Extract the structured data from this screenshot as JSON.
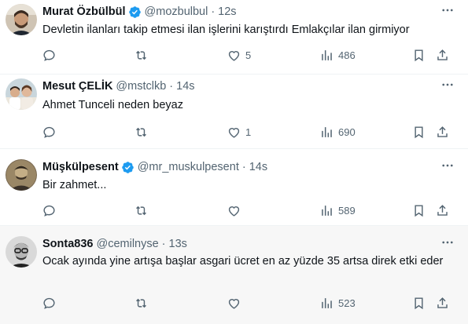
{
  "tweets": [
    {
      "name": "Murat Özbülbül",
      "handle": "@mozbulbul",
      "separator": "·",
      "time": "12s",
      "verified": true,
      "text": "Devletin ilanları takip etmesi ilan işlerini karıştırdı Emlakçılar ilan girmiyor",
      "likes": "5",
      "views": "486",
      "avatar": "avatar-man-beard"
    },
    {
      "name": "Mesut ÇELİK",
      "handle": "@mstclkb",
      "separator": "·",
      "time": "14s",
      "verified": false,
      "text": "Ahmet Tunceli neden beyaz",
      "likes": "1",
      "views": "690",
      "avatar": "avatar-group-photo"
    },
    {
      "name": "Müşkülpesent",
      "handle": "@mr_muskulpesent",
      "separator": "·",
      "time": "14s",
      "verified": true,
      "text": "Bir zahmet...",
      "likes": "",
      "views": "589",
      "avatar": "avatar-sepia-portrait"
    },
    {
      "name": "Sonta836",
      "handle": "@cemilnyse",
      "separator": "·",
      "time": "13s",
      "verified": false,
      "text": "Ocak ayında yine artışa başlar asgari ücret en az yüzde 35 artsa direk etki eder",
      "likes": "",
      "views": "523",
      "avatar": "avatar-bw-glasses"
    }
  ],
  "colors": {
    "verified": "#1d9bf0",
    "muted": "#536471",
    "text": "#0f1419",
    "divider": "#eff3f4",
    "highlight_bg": "#f7f7f7"
  },
  "icons": [
    "reply-icon",
    "retweet-icon",
    "like-icon",
    "views-icon",
    "bookmark-icon",
    "share-icon",
    "more-icon",
    "verified-icon"
  ]
}
